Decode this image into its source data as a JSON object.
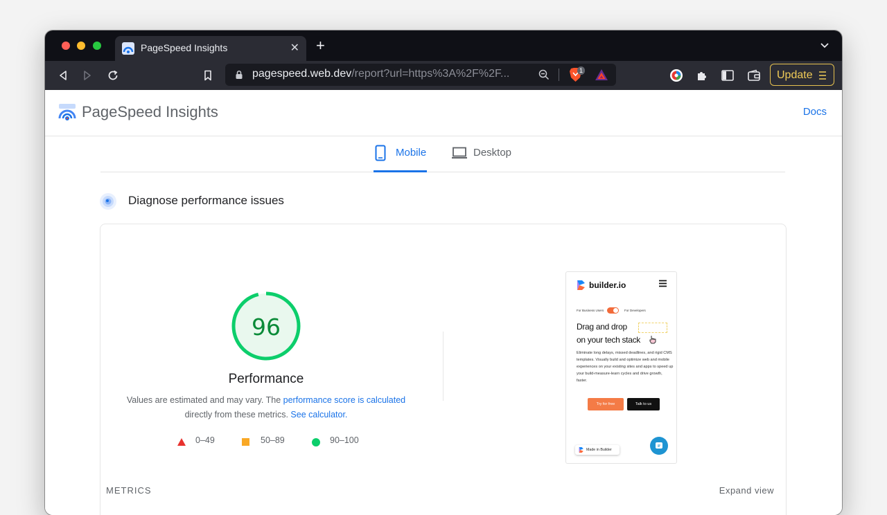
{
  "browser": {
    "tab_title": "PageSpeed Insights",
    "tab_close": "✕",
    "new_tab": "+",
    "url_host": "pagespeed.web.dev",
    "url_path": "/report?url=https%3A%2F%2F...",
    "brave_badge": "1",
    "update_label": "Update"
  },
  "header": {
    "title": "PageSpeed Insights",
    "docs_link": "Docs"
  },
  "device_tabs": {
    "mobile": "Mobile",
    "desktop": "Desktop",
    "active": "Mobile"
  },
  "section": {
    "title": "Diagnose performance issues"
  },
  "performance": {
    "score": "96",
    "score_fraction": 0.96,
    "label": "Performance",
    "desc_prefix": "Values are estimated and may vary. The ",
    "desc_link1": "performance score is calculated",
    "desc_middle": "directly from these metrics. ",
    "desc_link2": "See calculator.",
    "legend": [
      {
        "range": "0–49",
        "color": "#e8322e",
        "shape": "triangle"
      },
      {
        "range": "50–89",
        "color": "#f9a825",
        "shape": "square"
      },
      {
        "range": "90–100",
        "color": "#0cce6b",
        "shape": "circle"
      }
    ],
    "gauge_color": "#0cce6b",
    "gauge_fill": "#e9f8ee"
  },
  "screenshot": {
    "brand": "builder.io",
    "toggle_left": "For Business Users",
    "toggle_right": "For Developers",
    "headline_1": "Drag and drop",
    "headline_2": "on your tech stack",
    "body": "Eliminate long delays, missed deadlines, and rigid CMS templates. Visually build and optimize web and mobile experiences on your existing sites and apps to speed up your build-measure-learn cycles and drive growth, faster.",
    "btn_primary": "Try for free",
    "btn_secondary": "Talk to us",
    "badge": "Made in Builder"
  },
  "metrics": {
    "heading": "METRICS",
    "expand": "Expand view"
  }
}
